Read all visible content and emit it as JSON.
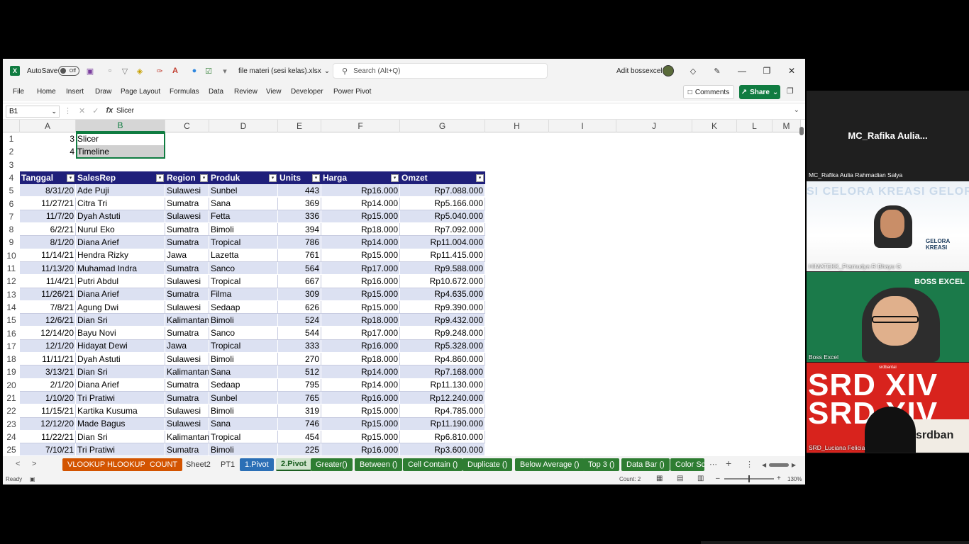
{
  "titlebar": {
    "app_icon": "X",
    "autosave_label": "AutoSave",
    "autosave_state": "Off",
    "file_name": "file materi (sesi kelas).xlsx",
    "search_placeholder": "Search (Alt+Q)",
    "user_name": "Adit bossexcel"
  },
  "menu": {
    "items": [
      "File",
      "Home",
      "Insert",
      "Draw",
      "Page Layout",
      "Formulas",
      "Data",
      "Review",
      "View",
      "Developer",
      "Power Pivot"
    ],
    "comments_label": "Comments",
    "share_label": "Share"
  },
  "formula_bar": {
    "name_box": "B1",
    "fx": "fx",
    "content": "Slicer"
  },
  "columns": [
    "A",
    "B",
    "C",
    "D",
    "E",
    "F",
    "G",
    "H",
    "I",
    "J",
    "K",
    "L",
    "M"
  ],
  "rows": [
    "1",
    "2",
    "3",
    "4",
    "5",
    "6",
    "7",
    "8",
    "9",
    "10",
    "11",
    "12",
    "13",
    "14",
    "15",
    "16",
    "17",
    "18",
    "19",
    "20",
    "21",
    "22",
    "23",
    "24",
    "25"
  ],
  "top_cells": {
    "a1": "3",
    "b1": "Slicer",
    "a2": "4",
    "b2": "Timeline"
  },
  "table": {
    "headers": [
      "Tanggal",
      "SalesRep",
      "Region",
      "Produk",
      "Units",
      "Harga",
      "Omzet"
    ],
    "rows": [
      [
        "8/31/20",
        "Ade Puji",
        "Sulawesi",
        "Sunbel",
        "443",
        "Rp16.000",
        "Rp7.088.000"
      ],
      [
        "11/27/21",
        "Citra Tri",
        "Sumatra",
        "Sana",
        "369",
        "Rp14.000",
        "Rp5.166.000"
      ],
      [
        "11/7/20",
        "Dyah Astuti",
        "Sulawesi",
        "Fetta",
        "336",
        "Rp15.000",
        "Rp5.040.000"
      ],
      [
        "6/2/21",
        "Nurul Eko",
        "Sumatra",
        "Bimoli",
        "394",
        "Rp18.000",
        "Rp7.092.000"
      ],
      [
        "8/1/20",
        "Diana Arief",
        "Sumatra",
        "Tropical",
        "786",
        "Rp14.000",
        "Rp11.004.000"
      ],
      [
        "11/14/21",
        "Hendra Rizky",
        "Jawa",
        "Lazetta",
        "761",
        "Rp15.000",
        "Rp11.415.000"
      ],
      [
        "11/13/20",
        "Muhamad Indra",
        "Sumatra",
        "Sanco",
        "564",
        "Rp17.000",
        "Rp9.588.000"
      ],
      [
        "11/4/21",
        "Putri Abdul",
        "Sulawesi",
        "Tropical",
        "667",
        "Rp16.000",
        "Rp10.672.000"
      ],
      [
        "11/26/21",
        "Diana Arief",
        "Sumatra",
        "Filma",
        "309",
        "Rp15.000",
        "Rp4.635.000"
      ],
      [
        "7/8/21",
        "Agung Dwi",
        "Sulawesi",
        "Sedaap",
        "626",
        "Rp15.000",
        "Rp9.390.000"
      ],
      [
        "12/6/21",
        "Dian Sri",
        "Kalimantan",
        "Bimoli",
        "524",
        "Rp18.000",
        "Rp9.432.000"
      ],
      [
        "12/14/20",
        "Bayu Novi",
        "Sumatra",
        "Sanco",
        "544",
        "Rp17.000",
        "Rp9.248.000"
      ],
      [
        "12/1/20",
        "Hidayat Dewi",
        "Jawa",
        "Tropical",
        "333",
        "Rp16.000",
        "Rp5.328.000"
      ],
      [
        "11/11/21",
        "Dyah Astuti",
        "Sulawesi",
        "Bimoli",
        "270",
        "Rp18.000",
        "Rp4.860.000"
      ],
      [
        "3/13/21",
        "Dian Sri",
        "Kalimantan",
        "Sana",
        "512",
        "Rp14.000",
        "Rp7.168.000"
      ],
      [
        "2/1/20",
        "Diana Arief",
        "Sumatra",
        "Sedaap",
        "795",
        "Rp14.000",
        "Rp11.130.000"
      ],
      [
        "1/10/20",
        "Tri Pratiwi",
        "Sumatra",
        "Sunbel",
        "765",
        "Rp16.000",
        "Rp12.240.000"
      ],
      [
        "11/15/21",
        "Kartika Kusuma",
        "Sulawesi",
        "Bimoli",
        "319",
        "Rp15.000",
        "Rp4.785.000"
      ],
      [
        "12/12/20",
        "Made Bagus",
        "Sulawesi",
        "Sana",
        "746",
        "Rp15.000",
        "Rp11.190.000"
      ],
      [
        "11/22/21",
        "Dian Sri",
        "Kalimantan",
        "Tropical",
        "454",
        "Rp15.000",
        "Rp6.810.000"
      ],
      [
        "7/10/21",
        "Tri Pratiwi",
        "Sumatra",
        "Bimoli",
        "225",
        "Rp16.000",
        "Rp3.600.000"
      ]
    ]
  },
  "sheet_tabs": [
    {
      "label": "VLOOKUP HLOOKUP",
      "style": "orange"
    },
    {
      "label": "COUNT",
      "style": "orange"
    },
    {
      "label": "Sheet2",
      "style": "plain"
    },
    {
      "label": "PT1",
      "style": "plain"
    },
    {
      "label": "1.Pivot",
      "style": "blue"
    },
    {
      "label": "2.Pivot",
      "style": "active"
    },
    {
      "label": "Greater()",
      "style": "green"
    },
    {
      "label": "Between ()",
      "style": "green"
    },
    {
      "label": "Cell Contain ()",
      "style": "green"
    },
    {
      "label": "Duplicate ()",
      "style": "green"
    },
    {
      "label": "Below Average ()",
      "style": "green"
    },
    {
      "label": "Top 3 ()",
      "style": "green"
    },
    {
      "label": "Data Bar ()",
      "style": "green"
    },
    {
      "label": "Color Sca",
      "style": "green"
    }
  ],
  "status": {
    "ready": "Ready",
    "count": "Count: 2",
    "zoom": "130%"
  },
  "video": {
    "top_name": "MC_Rafika  Aulia...",
    "top_label": "MC_Rafika Aulia Rahmadian Salya",
    "tile1_label": "HIMATEKK_Pramudya R Bhayu G",
    "tile1_bg": "SI CELORA KREASI GELORA",
    "tile1_logo": "GELORA KREASI",
    "tile2_label": "Boss Excel",
    "tile2_logo": "BOSS EXCEL",
    "tile3_label": "SRD_Luciana Felicia",
    "tile3_big": "SRD XIV",
    "tile3_small": "srdbantai",
    "tile3_paper": "srdban"
  }
}
